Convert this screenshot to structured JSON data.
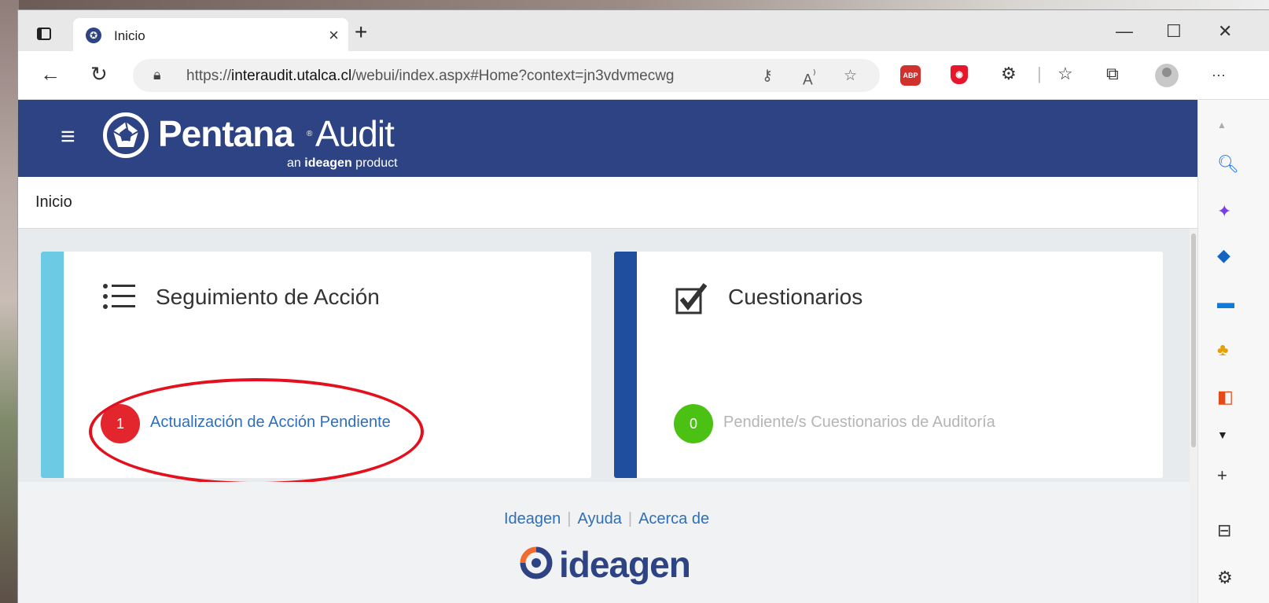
{
  "browser": {
    "tab_title": "Inicio",
    "new_tab_symbol": "+",
    "close_symbol": "×",
    "url_prefix": "https://",
    "url_domain": "interaudit.utalca.cl",
    "url_path": "/webui/index.aspx#Home?context=jn3vdvmecwg",
    "abp_label": "ABP",
    "window_controls": {
      "minimize": "—",
      "maximize": "☐",
      "close": "✕"
    },
    "more_symbol": "···"
  },
  "app": {
    "menu_symbol": "≡",
    "brand_name": "Pentana",
    "brand_reg": "®",
    "brand_product": "Audit",
    "brand_tagline_pre": "an",
    "brand_tagline_bold": "ideagen",
    "brand_tagline_post": "product",
    "accent_color": "#2d4383"
  },
  "breadcrumb": {
    "label": "Inicio"
  },
  "cards": [
    {
      "title": "Seguimiento de Acción",
      "icon": "list-icon",
      "stripe_color": "#6dcae4",
      "badge_value": "1",
      "badge_color": "#e3262d",
      "link_label": "Actualización de Acción Pendiente",
      "link_color": "#2f6fb9"
    },
    {
      "title": "Cuestionarios",
      "icon": "checkbox-icon",
      "stripe_color": "#1f4e9e",
      "badge_value": "0",
      "badge_color": "#4bc114",
      "link_label": "Pendiente/s Cuestionarios de Auditoría",
      "link_color": "#b5b5b5"
    }
  ],
  "footer": {
    "links": [
      "Ideagen",
      "Ayuda",
      "Acerca de"
    ],
    "logo_text": "ideagen"
  }
}
